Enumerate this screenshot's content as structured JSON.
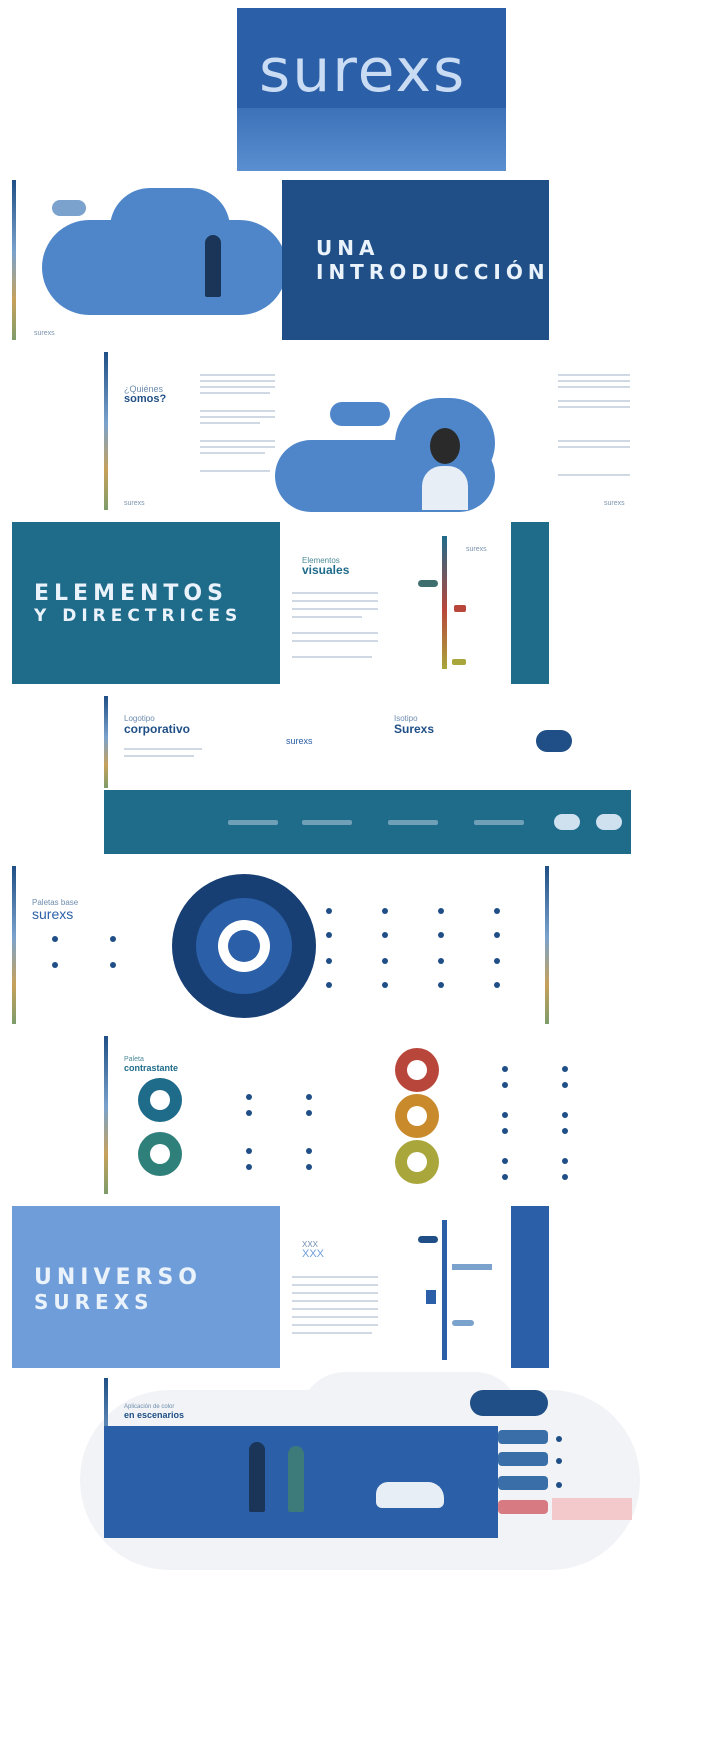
{
  "cover": {
    "logo_text": "surexs"
  },
  "intro": {
    "title_line1": "UNA",
    "title_line2": "INTRODUCCIÓN",
    "footer_left": "surexs"
  },
  "about": {
    "heading_small": "¿Quiénes",
    "heading_big": "somos?",
    "footer_left": "surexs",
    "footer_right": "surexs"
  },
  "elements": {
    "title_line1": "ELEMENTOS",
    "title_line2": "Y DIRECTRICES",
    "visual_small": "Elementos",
    "visual_big": "visuales",
    "side_label": "surexs"
  },
  "logos": {
    "corp_small": "Logotipo",
    "corp_big": "corporativo",
    "corp_wordmark": "surexs",
    "iso_small": "Isotipo",
    "iso_big": "Surexs"
  },
  "palettes": {
    "base_small": "Paletas base",
    "base_big": "surexs",
    "contrast_small": "Paleta",
    "contrast_big": "contrastante"
  },
  "universe": {
    "title_line1": "UNIVERSO",
    "title_line2": "SUREXS",
    "side_small": "XXX",
    "side_big": "XXX"
  },
  "scenarios": {
    "small": "Aplicación de color",
    "big": "en escenarios"
  },
  "colors": {
    "primary": "#2b5fa8",
    "dark": "#1f4f86",
    "teal": "#1e6b8a",
    "light": "#6f9dd9",
    "red": "#b8463b",
    "orange": "#c98a2c",
    "olive": "#a9a63b"
  }
}
